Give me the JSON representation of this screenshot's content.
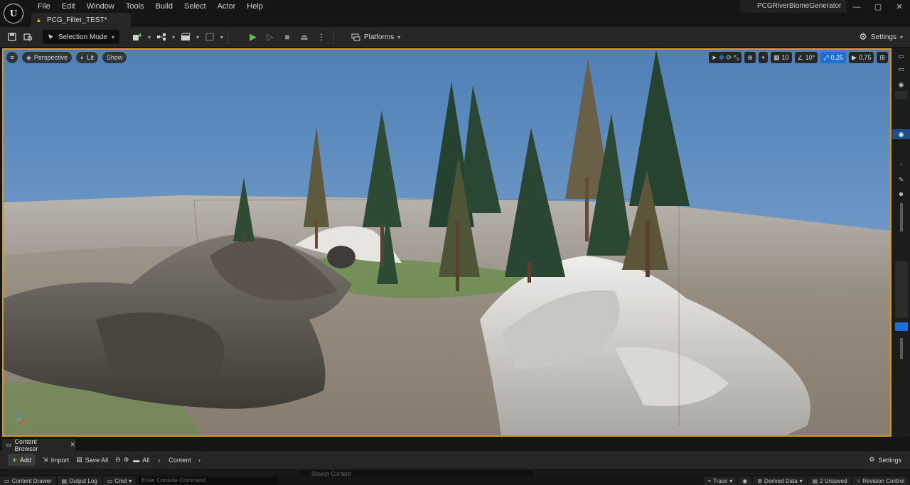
{
  "app": {
    "logo": "U"
  },
  "menu": [
    "File",
    "Edit",
    "Window",
    "Tools",
    "Build",
    "Select",
    "Actor",
    "Help"
  ],
  "document_tab": {
    "label": "PCG_Filter_TEST*"
  },
  "project_name": "PCGRiverBiomeGenerator",
  "window_buttons": {
    "minimize": "—",
    "maximize": "▢",
    "close": "✕"
  },
  "toolbar": {
    "selection_mode": "Selection Mode",
    "platforms": "Platforms",
    "settings": "Settings"
  },
  "viewport": {
    "perspective": "Perspective",
    "lit": "Lit",
    "show": "Show",
    "grid_snap": "10",
    "rotation_snap": "10°",
    "scale_snap": "0,25",
    "camera_speed": "0,75"
  },
  "content_browser": {
    "tab_label": "Content Browser",
    "add": "Add",
    "import": "Import",
    "save_all": "Save All",
    "breadcrumb_all": "All",
    "breadcrumb_content": "Content",
    "settings": "Settings",
    "search_placeholder": "Search Content"
  },
  "statusbar": {
    "content_drawer": "Content Drawer",
    "output_log": "Output Log",
    "cmd": "Cmd",
    "console_placeholder": "Enter Console Command",
    "trace": "Trace",
    "derived_data": "Derived Data",
    "unsaved": "2 Unsaved",
    "revision_control": "Revision Control"
  },
  "colors": {
    "accent_frame": "#d49a20",
    "play_green": "#56c356",
    "active_blue": "#1d6fd8"
  }
}
